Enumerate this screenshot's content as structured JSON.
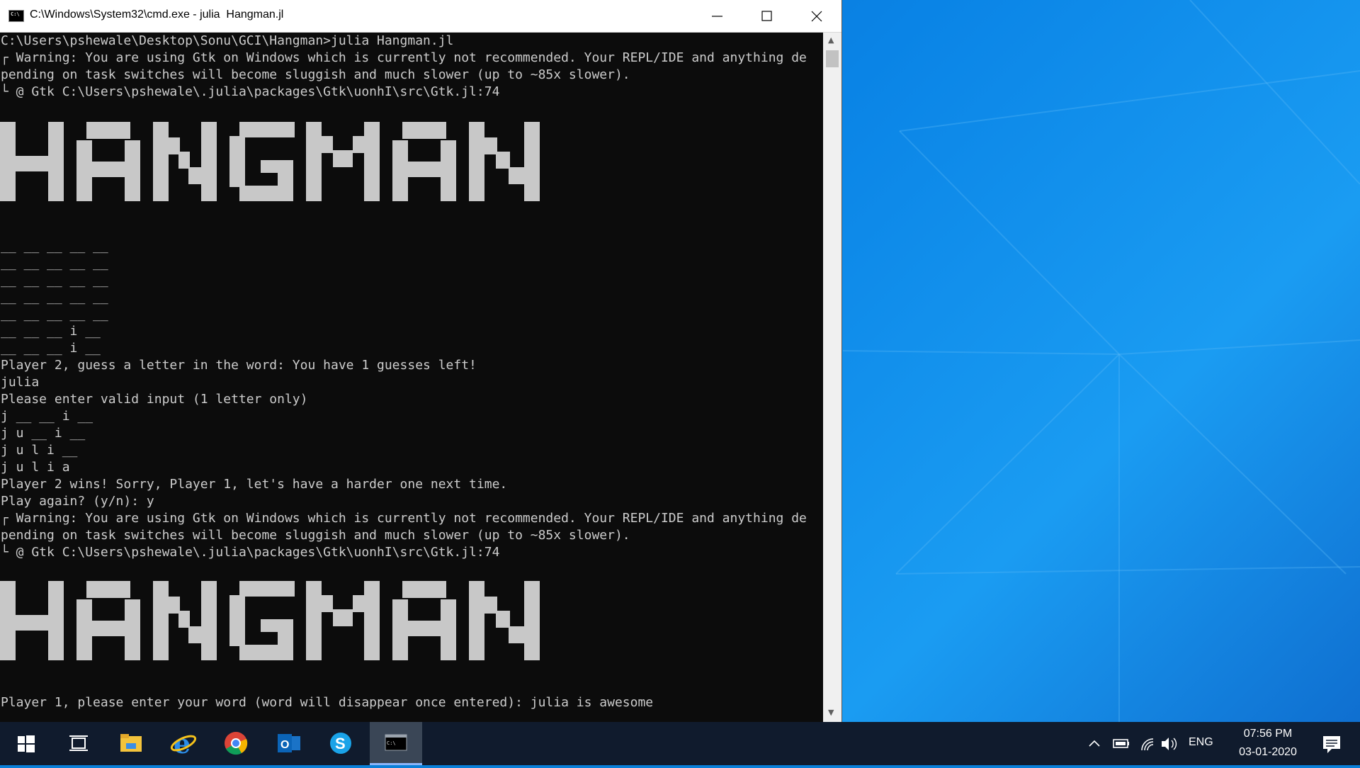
{
  "window": {
    "title": "C:\\Windows\\System32\\cmd.exe - julia  Hangman.jl",
    "minimize": "minimize",
    "maximize": "maximize",
    "close": "close"
  },
  "console": {
    "lines_top": [
      "C:\\Users\\pshewale\\Desktop\\Sonu\\GCI\\Hangman>julia Hangman.jl",
      "┌ Warning: You are using Gtk on Windows which is currently not recommended. Your REPL/IDE and anything de",
      "pending on task switches will become sluggish and much slower (up to ~85x slower).",
      "└ @ Gtk C:\\Users\\pshewale\\.julia\\packages\\Gtk\\uonhI\\src\\Gtk.jl:74"
    ],
    "banner_text": "HANGMAN",
    "lines_middle": [
      "__ __ __ __ __",
      "__ __ __ __ __",
      "__ __ __ __ __",
      "__ __ __ __ __",
      "__ __ __ __ __",
      "__ __ __ i __",
      "__ __ __ i __",
      "Player 2, guess a letter in the word: You have 1 guesses left!",
      "julia",
      "Please enter valid input (1 letter only)",
      "j __ __ i __",
      "j u __ i __",
      "j u l i __",
      "j u l i a",
      "Player 2 wins! Sorry, Player 1, let's have a harder one next time.",
      "Play again? (y/n): y",
      "┌ Warning: You are using Gtk on Windows which is currently not recommended. Your REPL/IDE and anything de",
      "pending on task switches will become sluggish and much slower (up to ~85x slower).",
      "└ @ Gtk C:\\Users\\pshewale\\.julia\\packages\\Gtk\\uonhI\\src\\Gtk.jl:74"
    ],
    "line_bottom": "Player 1, please enter your word (word will disappear once entered): julia is awesome"
  },
  "taskbar": {
    "items": [
      "start-icon",
      "task-view-icon",
      "file-explorer-icon",
      "internet-explorer-icon",
      "chrome-icon",
      "outlook-icon",
      "skype-icon",
      "cmd-icon"
    ],
    "language": "ENG",
    "time": "07:56 PM",
    "date": "03-01-2020"
  },
  "colors": {
    "console_bg": "#0c0c0c",
    "console_text": "#cccccc",
    "banner": "#c8c8c8",
    "taskbar": "#101b2d"
  }
}
